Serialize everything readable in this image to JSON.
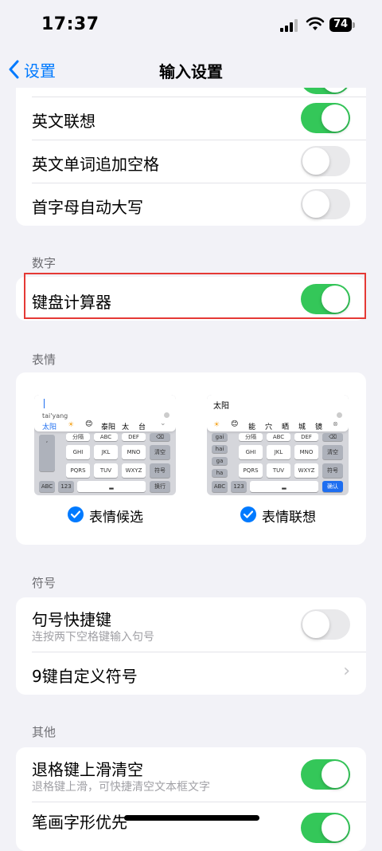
{
  "status_bar": {
    "time": "17:37",
    "battery": "74"
  },
  "nav": {
    "back_label": "设置",
    "title": "输入设置"
  },
  "english_group": {
    "items": [
      {
        "label": "英文联想",
        "on": true
      },
      {
        "label": "英文单词追加空格",
        "on": false
      },
      {
        "label": "首字母自动大写",
        "on": false
      }
    ]
  },
  "number_section": {
    "header": "数字",
    "items": [
      {
        "label": "键盘计算器",
        "on": true
      }
    ]
  },
  "emoji_section": {
    "header": "表情",
    "left_preview": {
      "pinyin": "tai'yang",
      "candidates": [
        "太阳",
        "☀",
        "😊",
        "泰阳",
        "太",
        "台"
      ],
      "keys_row1": [
        "分隔",
        "ABC",
        "DEF"
      ],
      "keys_row2": [
        "GHI",
        "JKL",
        "MNO",
        "清空"
      ],
      "keys_row3": [
        "PQRS",
        "TUV",
        "WXYZ",
        "符号"
      ],
      "keys_row4": [
        "ABC",
        "123",
        "换行"
      ],
      "side_keys": [
        ",",
        "。",
        "?",
        "!"
      ]
    },
    "right_preview": {
      "input": "太阳",
      "candidates": [
        "☀",
        "😊",
        "能",
        "穴",
        "晒",
        "城",
        "镜"
      ],
      "keys_row1": [
        "分隔",
        "ABC",
        "DEF"
      ],
      "keys_row2": [
        "GHI",
        "JKL",
        "MNO",
        "清空"
      ],
      "keys_row3": [
        "PQRS",
        "TUV",
        "WXYZ",
        "符号"
      ],
      "keys_row4": [
        "ABC",
        "123",
        "确认"
      ],
      "side_keys": [
        "gai",
        "hai",
        "ga",
        "ha"
      ]
    },
    "options": [
      {
        "label": "表情候选",
        "checked": true
      },
      {
        "label": "表情联想",
        "checked": true
      }
    ]
  },
  "symbol_section": {
    "header": "符号",
    "quick_period": {
      "label": "句号快捷键",
      "sublabel": "连按两下空格键输入句号",
      "on": false
    },
    "custom_symbols": {
      "label": "9键自定义符号"
    }
  },
  "other_section": {
    "header": "其他",
    "backspace_clear": {
      "label": "退格键上滑清空",
      "sublabel": "退格键上滑，可快捷清空文本框文字",
      "on": true
    },
    "stroke_priority": {
      "label": "笔画字形优先",
      "on": true
    }
  },
  "colors": {
    "accent": "#007aff",
    "toggle_on": "#34c759",
    "highlight": "#e53935"
  }
}
